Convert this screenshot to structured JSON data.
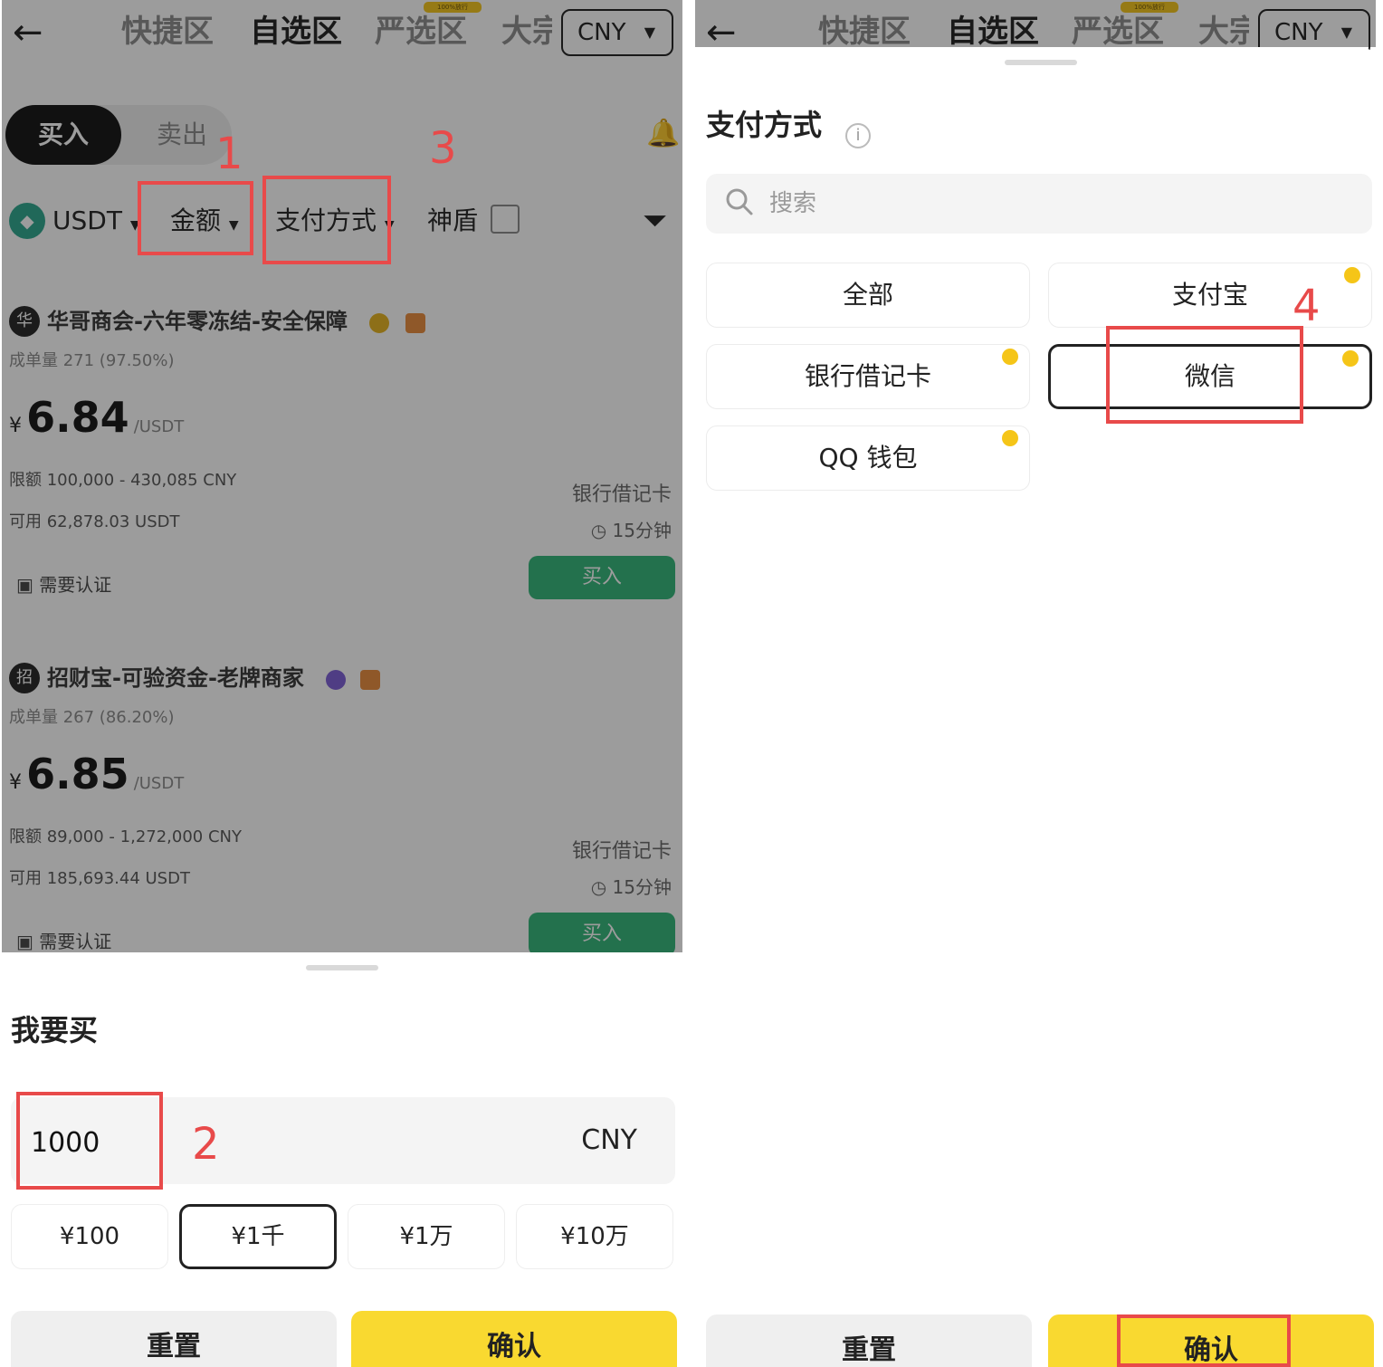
{
  "left": {
    "topbar": {
      "back": "←",
      "tabs": [
        "快捷区",
        "自选区",
        "严选区",
        "大宗"
      ],
      "tab_badge": "100%放行",
      "currency": "CNY"
    },
    "segment": {
      "buy": "买入",
      "sell": "卖出"
    },
    "filters": {
      "coin": "USDT",
      "amount": "金额",
      "payment": "支付方式",
      "shield": "神盾"
    },
    "ads": [
      {
        "avatar": "华",
        "name": "华哥商会-六年零冻结-安全保障",
        "stats": "成单量 271 (97.50%)",
        "currency_symbol": "¥",
        "price": "6.84",
        "unit": "/USDT",
        "limit": "限额 100,000 - 430,085 CNY",
        "available": "可用 62,878.03 USDT",
        "pay_method": "银行借记卡",
        "time": "◷ 15分钟",
        "verify": "需要认证",
        "buy_label": "买入"
      },
      {
        "avatar": "招",
        "name": "招财宝-可验资金-老牌商家",
        "stats": "成单量 267 (86.20%)",
        "currency_symbol": "¥",
        "price": "6.85",
        "unit": "/USDT",
        "limit": "限额 89,000 - 1,272,000 CNY",
        "available": "可用 185,693.44 USDT",
        "pay_method": "银行借记卡",
        "time": "◷ 15分钟",
        "verify": "需要认证",
        "buy_label": "买入"
      }
    ],
    "sheet": {
      "title": "我要买",
      "amount_value": "1000",
      "amount_currency": "CNY",
      "quick_amounts": [
        "¥100",
        "¥1千",
        "¥1万",
        "¥10万"
      ],
      "selected_quick": 1,
      "reset": "重置",
      "confirm": "确认"
    },
    "annotations": [
      "1",
      "2",
      "3"
    ]
  },
  "right": {
    "topbar": {
      "back": "←",
      "tabs": [
        "快捷区",
        "自选区",
        "严选区",
        "大宗"
      ],
      "tab_badge": "100%放行",
      "currency": "CNY"
    },
    "sheet": {
      "title": "支付方式",
      "info": "i",
      "search_placeholder": "搜索",
      "options": [
        "全部",
        "支付宝",
        "银行借记卡",
        "微信",
        "QQ 钱包"
      ],
      "selected_option": "微信",
      "reset": "重置",
      "confirm": "确认"
    },
    "annotations": [
      "4"
    ]
  },
  "colors": {
    "accent_yellow": "#f9d930",
    "buy_green": "#2fb577",
    "annotation_red": "#e84a4a",
    "overlay": "rgba(20,20,20,0.42)"
  }
}
